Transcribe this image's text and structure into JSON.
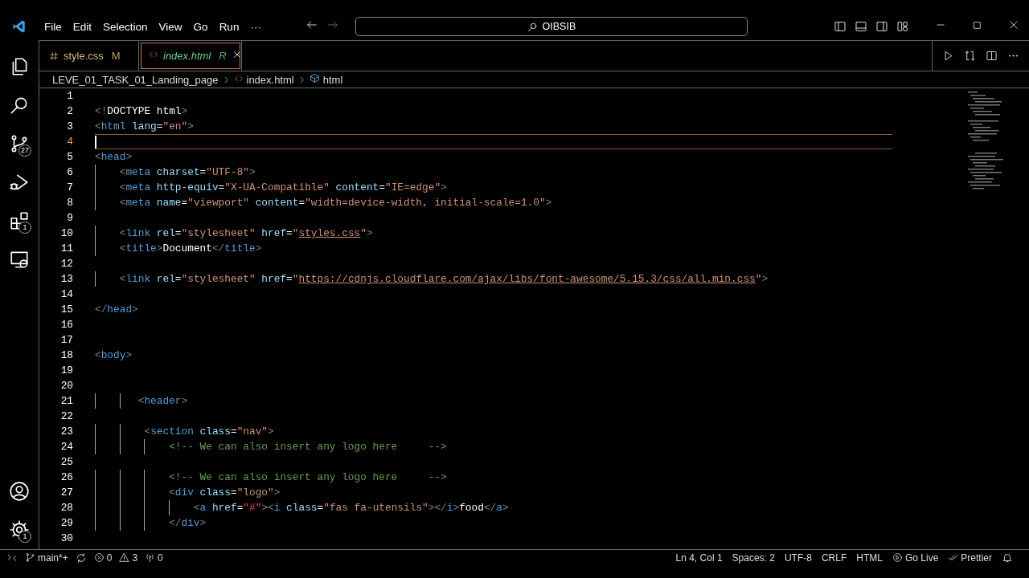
{
  "menu": [
    "File",
    "Edit",
    "Selection",
    "View",
    "Go",
    "Run",
    "···"
  ],
  "search": {
    "value": "OIBSIB"
  },
  "activity_bar": [
    {
      "kind": "files",
      "selected": false
    },
    {
      "kind": "search",
      "selected": false
    },
    {
      "kind": "source-control",
      "badge": "27",
      "selected": false
    },
    {
      "kind": "run-debug",
      "selected": false
    },
    {
      "kind": "extensions",
      "badge": "1",
      "selected": false
    },
    {
      "kind": "remote",
      "selected": false
    }
  ],
  "activity_bottom": [
    {
      "kind": "account"
    },
    {
      "kind": "settings",
      "badge": "1"
    }
  ],
  "tabs": [
    {
      "kind": "css",
      "label": "style.css",
      "status": "M",
      "selected": false
    },
    {
      "kind": "html",
      "label": "index.html",
      "status": "R",
      "selected": true
    }
  ],
  "breadcrumbs": [
    {
      "kind": "folder",
      "label": "LEVE_01_TASK_01_Landing_page"
    },
    {
      "kind": "html",
      "label": "index.html"
    },
    {
      "kind": "element",
      "label": "html"
    }
  ],
  "lines": [
    {
      "number": "1",
      "current": false
    },
    {
      "number": "2",
      "current": false,
      "tokens": [
        {
          "kind": "punct",
          "text": "<!"
        },
        {
          "kind": "keyword",
          "text": "DOCTYPE html"
        },
        {
          "kind": "punct",
          "text": ">"
        }
      ]
    },
    {
      "number": "3",
      "current": false,
      "tokens": [
        {
          "kind": "punct",
          "text": "<"
        },
        {
          "kind": "tag",
          "text": "html"
        },
        {
          "kind": "attr",
          "text": " lang"
        },
        {
          "kind": "text",
          "text": "="
        },
        {
          "kind": "string",
          "text": "\"en\""
        },
        {
          "kind": "punct",
          "text": ">"
        }
      ]
    },
    {
      "number": "4",
      "current": true
    },
    {
      "number": "5",
      "current": false,
      "tokens": [
        {
          "kind": "punct",
          "text": "<"
        },
        {
          "kind": "tag",
          "text": "head"
        },
        {
          "kind": "punct",
          "text": ">"
        }
      ]
    },
    {
      "number": "6",
      "current": false,
      "tokens": [
        {
          "kind": "punct",
          "text": "    <"
        },
        {
          "kind": "tag",
          "text": "meta"
        },
        {
          "kind": "attr",
          "text": " charset"
        },
        {
          "kind": "text",
          "text": "="
        },
        {
          "kind": "string",
          "text": "\"UTF-8\""
        },
        {
          "kind": "punct",
          "text": ">"
        }
      ]
    },
    {
      "number": "7",
      "current": false,
      "tokens": [
        {
          "kind": "punct",
          "text": "    <"
        },
        {
          "kind": "tag",
          "text": "meta"
        },
        {
          "kind": "attr",
          "text": " http-equiv"
        },
        {
          "kind": "text",
          "text": "="
        },
        {
          "kind": "string",
          "text": "\"X-UA-Compatible\""
        },
        {
          "kind": "attr",
          "text": " content"
        },
        {
          "kind": "text",
          "text": "="
        },
        {
          "kind": "string",
          "text": "\"IE=edge\""
        },
        {
          "kind": "punct",
          "text": ">"
        }
      ]
    },
    {
      "number": "8",
      "current": false,
      "tokens": [
        {
          "kind": "punct",
          "text": "    <"
        },
        {
          "kind": "tag",
          "text": "meta"
        },
        {
          "kind": "attr",
          "text": " name"
        },
        {
          "kind": "text",
          "text": "="
        },
        {
          "kind": "string",
          "text": "\"viewport\""
        },
        {
          "kind": "attr",
          "text": " content"
        },
        {
          "kind": "text",
          "text": "="
        },
        {
          "kind": "string",
          "text": "\"width=device-width, initial-scale=1.0\""
        },
        {
          "kind": "punct",
          "text": ">"
        }
      ]
    },
    {
      "number": "9",
      "current": false
    },
    {
      "number": "10",
      "current": false,
      "tokens": [
        {
          "kind": "punct",
          "text": "    <"
        },
        {
          "kind": "tag",
          "text": "link"
        },
        {
          "kind": "attr",
          "text": " rel"
        },
        {
          "kind": "text",
          "text": "="
        },
        {
          "kind": "string",
          "text": "\"stylesheet\""
        },
        {
          "kind": "attr",
          "text": " href"
        },
        {
          "kind": "text",
          "text": "="
        },
        {
          "kind": "string",
          "text": "\""
        },
        {
          "kind": "link",
          "text": "styles.css"
        },
        {
          "kind": "string",
          "text": "\""
        },
        {
          "kind": "punct",
          "text": ">"
        }
      ]
    },
    {
      "number": "11",
      "current": false,
      "tokens": [
        {
          "kind": "punct",
          "text": "    <"
        },
        {
          "kind": "tag",
          "text": "title"
        },
        {
          "kind": "punct",
          "text": ">"
        },
        {
          "kind": "text",
          "text": "Document"
        },
        {
          "kind": "punct",
          "text": "</"
        },
        {
          "kind": "tag",
          "text": "title"
        },
        {
          "kind": "punct",
          "text": ">"
        }
      ]
    },
    {
      "number": "12",
      "current": false
    },
    {
      "number": "13",
      "current": false,
      "tokens": [
        {
          "kind": "punct",
          "text": "    <"
        },
        {
          "kind": "tag",
          "text": "link"
        },
        {
          "kind": "attr",
          "text": " rel"
        },
        {
          "kind": "text",
          "text": "="
        },
        {
          "kind": "string",
          "text": "\"stylesheet\""
        },
        {
          "kind": "attr",
          "text": " href"
        },
        {
          "kind": "text",
          "text": "="
        },
        {
          "kind": "string",
          "text": "\""
        },
        {
          "kind": "link",
          "text": "https://cdnjs.cloudflare.com/ajax/libs/font-awesome/5.15.3/css/all.min.css"
        },
        {
          "kind": "string",
          "text": "\""
        },
        {
          "kind": "punct",
          "text": ">"
        }
      ]
    },
    {
      "number": "14",
      "current": false
    },
    {
      "number": "15",
      "current": false,
      "tokens": [
        {
          "kind": "punct",
          "text": "</"
        },
        {
          "kind": "tag",
          "text": "head"
        },
        {
          "kind": "punct",
          "text": ">"
        }
      ]
    },
    {
      "number": "16",
      "current": false
    },
    {
      "number": "17",
      "current": false
    },
    {
      "number": "18",
      "current": false,
      "tokens": [
        {
          "kind": "punct",
          "text": "<"
        },
        {
          "kind": "tag",
          "text": "body"
        },
        {
          "kind": "punct",
          "text": ">"
        }
      ]
    },
    {
      "number": "19",
      "current": false
    },
    {
      "number": "20",
      "current": false
    },
    {
      "number": "21",
      "current": false,
      "tokens": [
        {
          "kind": "punct",
          "text": "       <"
        },
        {
          "kind": "tag",
          "text": "header"
        },
        {
          "kind": "punct",
          "text": ">"
        }
      ]
    },
    {
      "number": "22",
      "current": false
    },
    {
      "number": "23",
      "current": false,
      "tokens": [
        {
          "kind": "punct",
          "text": "        <"
        },
        {
          "kind": "tag",
          "text": "section"
        },
        {
          "kind": "attr",
          "text": " class"
        },
        {
          "kind": "text",
          "text": "="
        },
        {
          "kind": "string",
          "text": "\"nav\""
        },
        {
          "kind": "punct",
          "text": ">"
        }
      ]
    },
    {
      "number": "24",
      "current": false,
      "tokens": [
        {
          "kind": "comment",
          "text": "            <!-- We can also insert any logo here     -->"
        }
      ]
    },
    {
      "number": "25",
      "current": false
    },
    {
      "number": "26",
      "current": false,
      "tokens": [
        {
          "kind": "comment",
          "text": "            <!-- We can also insert any logo here     -->"
        }
      ]
    },
    {
      "number": "27",
      "current": false,
      "tokens": [
        {
          "kind": "punct",
          "text": "            <"
        },
        {
          "kind": "tag",
          "text": "div"
        },
        {
          "kind": "attr",
          "text": " class"
        },
        {
          "kind": "text",
          "text": "="
        },
        {
          "kind": "string",
          "text": "\"logo\""
        },
        {
          "kind": "punct",
          "text": ">"
        }
      ]
    },
    {
      "number": "28",
      "current": false,
      "tokens": [
        {
          "kind": "punct",
          "text": "                <"
        },
        {
          "kind": "tag",
          "text": "a"
        },
        {
          "kind": "attr",
          "text": " href"
        },
        {
          "kind": "text",
          "text": "="
        },
        {
          "kind": "hash",
          "text": "\"#\""
        },
        {
          "kind": "punct",
          "text": "><"
        },
        {
          "kind": "tag",
          "text": "i"
        },
        {
          "kind": "attr",
          "text": " class"
        },
        {
          "kind": "text",
          "text": "="
        },
        {
          "kind": "string",
          "text": "\"fas fa-utensils\""
        },
        {
          "kind": "punct",
          "text": "></"
        },
        {
          "kind": "tag",
          "text": "i"
        },
        {
          "kind": "punct",
          "text": ">"
        },
        {
          "kind": "text",
          "text": "food"
        },
        {
          "kind": "punct",
          "text": "</"
        },
        {
          "kind": "tag",
          "text": "a"
        },
        {
          "kind": "punct",
          "text": ">"
        }
      ]
    },
    {
      "number": "29",
      "current": false,
      "tokens": [
        {
          "kind": "punct",
          "text": "            </"
        },
        {
          "kind": "tag",
          "text": "div"
        },
        {
          "kind": "punct",
          "text": ">"
        }
      ]
    },
    {
      "number": "30",
      "current": false
    }
  ],
  "status_left": [
    {
      "kind": "remote"
    },
    {
      "kind": "branch",
      "label": "main*+"
    },
    {
      "kind": "sync"
    },
    {
      "kind": "errors",
      "label": "0"
    },
    {
      "kind": "warnings",
      "label": "3"
    },
    {
      "kind": "ports",
      "label": "0"
    }
  ],
  "status_right": [
    {
      "kind": "text",
      "label": "Ln 4, Col 1"
    },
    {
      "kind": "text",
      "label": "Spaces: 2"
    },
    {
      "kind": "text",
      "label": "UTF-8"
    },
    {
      "kind": "text",
      "label": "CRLF"
    },
    {
      "kind": "text",
      "label": "HTML"
    },
    {
      "kind": "golive",
      "label": "Go Live"
    },
    {
      "kind": "prettier",
      "label": "Prettier"
    },
    {
      "kind": "bell"
    }
  ]
}
